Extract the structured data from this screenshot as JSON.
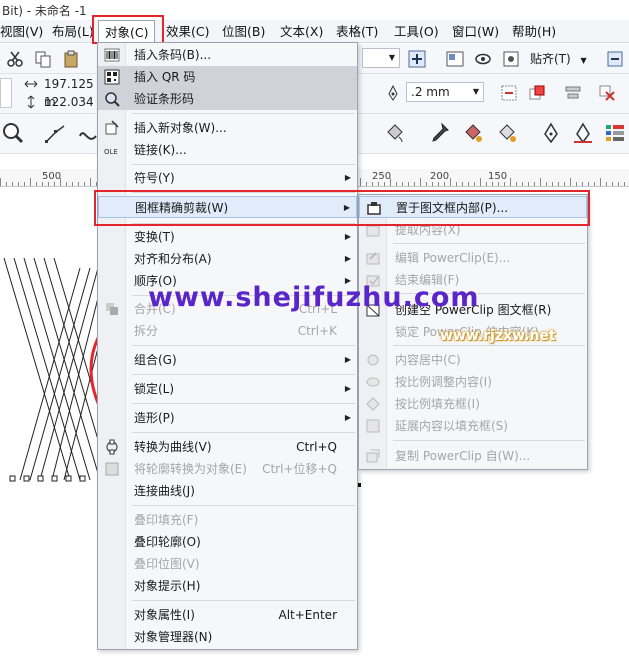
{
  "window": {
    "title": "Bit) - 未命名 -1"
  },
  "menubar": {
    "items": [
      "视图(V)",
      "布局(L)",
      "对象(C)",
      "效果(C)",
      "位图(B)",
      "文本(X)",
      "表格(T)",
      "工具(O)",
      "窗口(W)",
      "帮助(H)"
    ]
  },
  "toolbar": {
    "width_value": "197.125 m",
    "height_value": "122.034 m",
    "outline_width": ".2 mm",
    "snap_label": "贴齐(T)"
  },
  "ruler": {
    "labels": [
      "500",
      "250",
      "200",
      "150"
    ]
  },
  "object_menu": {
    "items": [
      {
        "label": "插入条码(B)...",
        "icon": "barcode-icon"
      },
      {
        "label": "插入 QR 码",
        "icon": "qr-code-icon",
        "state": "highlighted"
      },
      {
        "label": "验证条形码",
        "icon": "magnifier-icon",
        "state": "highlighted"
      },
      {
        "label": "插入新对象(W)...",
        "icon": "insert-object-icon"
      },
      {
        "label": "链接(K)...",
        "icon": "ole-icon"
      },
      {
        "label": "符号(Y)",
        "submenu": true
      },
      {
        "label": "图框精确剪裁(W)",
        "submenu": true,
        "state": "selected"
      },
      {
        "label": "变换(T)",
        "submenu": true
      },
      {
        "label": "对齐和分布(A)",
        "submenu": true
      },
      {
        "label": "顺序(O)",
        "submenu": true
      },
      {
        "label": "合并(C)",
        "shortcut": "Ctrl+L",
        "icon": "combine-icon",
        "state": "disabled"
      },
      {
        "label": "拆分",
        "shortcut": "Ctrl+K",
        "state": "disabled"
      },
      {
        "label": "组合(G)",
        "submenu": true
      },
      {
        "label": "锁定(L)",
        "submenu": true
      },
      {
        "label": "造形(P)",
        "submenu": true
      },
      {
        "label": "转换为曲线(V)",
        "shortcut": "Ctrl+Q",
        "icon": "convert-curve-icon"
      },
      {
        "label": "将轮廓转换为对象(E)",
        "shortcut": "Ctrl+位移+Q",
        "icon": "outline-object-icon",
        "state": "disabled"
      },
      {
        "label": "连接曲线(J)"
      },
      {
        "label": "叠印填充(F)",
        "state": "disabled"
      },
      {
        "label": "叠印轮廓(O)"
      },
      {
        "label": "叠印位图(V)",
        "state": "disabled"
      },
      {
        "label": "对象提示(H)"
      },
      {
        "label": "对象属性(I)",
        "shortcut": "Alt+Enter"
      },
      {
        "label": "对象管理器(N)"
      }
    ]
  },
  "powerclip_submenu": {
    "items": [
      {
        "label": "置于图文框内部(P)...",
        "icon": "place-in-frame-icon"
      },
      {
        "label": "提取内容(X)",
        "state": "disabled"
      },
      {
        "label": "编辑 PowerClip(E)...",
        "state": "disabled"
      },
      {
        "label": "结束编辑(F)",
        "state": "disabled"
      },
      {
        "label": "创建空 PowerClip 图文框(R)"
      },
      {
        "label": "锁定 PowerClip 的内容(K)",
        "state": "disabled"
      },
      {
        "label": "内容居中(C)",
        "state": "disabled"
      },
      {
        "label": "按比例调整内容(I)",
        "state": "disabled"
      },
      {
        "label": "按比例填充框(I)",
        "state": "disabled"
      },
      {
        "label": "延展内容以填充框(S)",
        "state": "disabled"
      },
      {
        "label": "复制 PowerClip 自(W)...",
        "state": "disabled"
      }
    ]
  },
  "watermarks": {
    "main": "www.shejifuzhu.com",
    "small": "www.rjzxw.net"
  },
  "colors": {
    "highlight_red": "#e3262b",
    "menu_bg": "#f6f7f9",
    "selected_bg": "#e1ebfa"
  }
}
